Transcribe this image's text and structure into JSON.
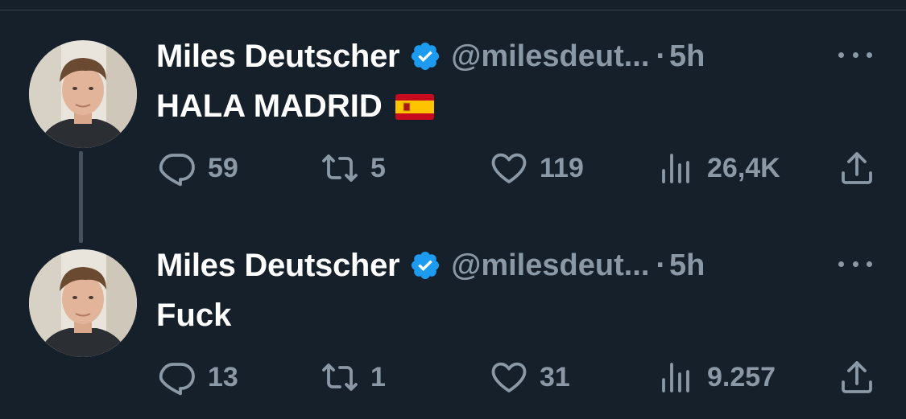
{
  "theme": {
    "background": "#15202b",
    "text": "#ffffff",
    "muted": "#8b98a5",
    "verified": "#1d9bf0"
  },
  "tweets": [
    {
      "author_name": "Miles Deutscher",
      "handle": "@milesdeut...",
      "separator": "·",
      "time": "5h",
      "text": "HALA MADRID",
      "emoji": "spain-flag",
      "reply_count": "59",
      "retweet_count": "5",
      "like_count": "119",
      "view_count": "26,4K"
    },
    {
      "author_name": "Miles Deutscher",
      "handle": "@milesdeut...",
      "separator": "·",
      "time": "5h",
      "text": "Fuck",
      "reply_count": "13",
      "retweet_count": "1",
      "like_count": "31",
      "view_count": "9.257"
    }
  ]
}
